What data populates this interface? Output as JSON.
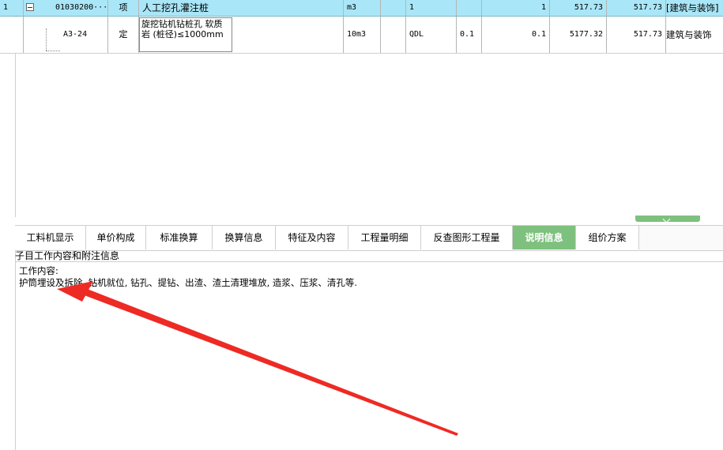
{
  "rows": [
    {
      "index": "1",
      "code": "01030200···",
      "category": "项",
      "name": "人工挖孔灌注桩",
      "unit": "m3",
      "quantity_expr": "1",
      "coefficient": "",
      "quantity": "1",
      "unit_price": "517.73",
      "total_price": "517.73",
      "specialty": "[建筑与装饰]"
    },
    {
      "index": "",
      "code": "A3-24",
      "category": "定",
      "name": "旋挖钻机钻桩孔 软质岩 (桩径)≤1000mm",
      "unit": "10m3",
      "quantity_expr": "QDL",
      "coefficient": "0.1",
      "quantity": "0.1",
      "unit_price": "5177.32",
      "total_price": "517.73",
      "specialty": "建筑与装饰"
    }
  ],
  "tabs": [
    "工料机显示",
    "单价构成",
    "标准换算",
    "换算信息",
    "特征及内容",
    "工程量明细",
    "反查图形工程量",
    "说明信息",
    "组价方案"
  ],
  "active_tab": "说明信息",
  "section_title": "子目工作内容和附注信息",
  "content": {
    "heading": "工作内容:",
    "body": "护筒埋设及拆除, 钻机就位, 钻孔、提钻、出渣、渣土清理堆放, 造浆、压浆、清孔等."
  },
  "colors": {
    "selected_row": "#a9e6f7",
    "active_tab": "#7ec07e",
    "arrow": "#ee2a24"
  }
}
